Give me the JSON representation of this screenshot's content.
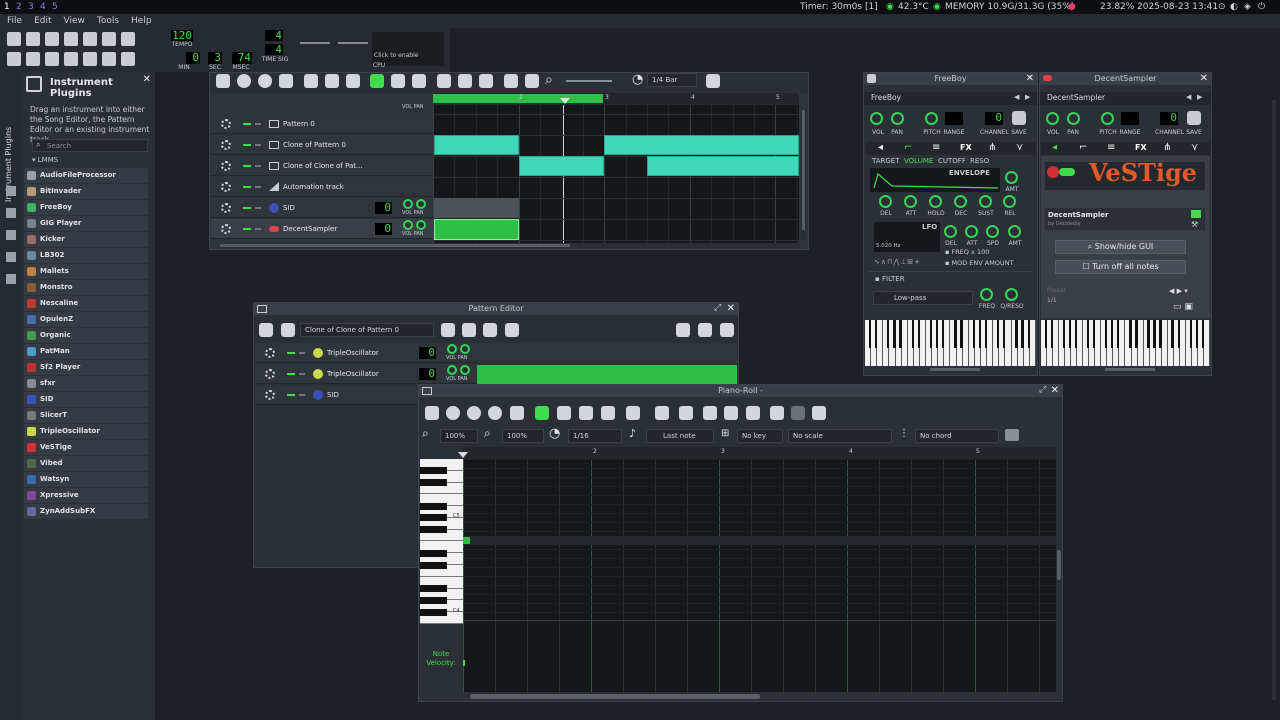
{
  "system_bar": {
    "workspaces": [
      "1",
      "2",
      "3",
      "4",
      "5"
    ],
    "timer": "Timer: 30m0s [1]",
    "temp": "42.3°C",
    "memory": "MEMORY 10.9G/31.3G (35%)",
    "cpu": "23.82%",
    "datetime": "2025-08-23 13:41"
  },
  "menu": [
    "File",
    "Edit",
    "View",
    "Tools",
    "Help"
  ],
  "toolbar": {
    "tempo_value": "120",
    "tempo_label": "TEMPO",
    "min_value": "0",
    "min_label": "MIN",
    "sec_value": "3",
    "sec_label": "SEC",
    "msec_value": "74",
    "msec_label": "MSEC",
    "timesig_num": "4",
    "timesig_den": "4",
    "timesig_label": "TIME SIG",
    "cpu_hint": "Click to enable",
    "cpu_label": "CPU"
  },
  "left_tabs": [
    "Instrument Plugins"
  ],
  "sidebar": {
    "title": "Instrument Plugins",
    "description": "Drag an instrument into either the Song Editor, the Pattern Editor or an existing instrument track.",
    "search_placeholder": "Search",
    "group": "LMMS",
    "plugins": [
      "AudioFileProcessor",
      "BitInvader",
      "FreeBoy",
      "GIG Player",
      "Kicker",
      "LB302",
      "Mallets",
      "Monstro",
      "Nescaline",
      "OpulenZ",
      "Organic",
      "PatMan",
      "Sf2 Player",
      "sfxr",
      "SID",
      "SlicerT",
      "TripleOscillator",
      "VeSTige",
      "Vibed",
      "Watsyn",
      "Xpressive",
      "ZynAddSubFX"
    ]
  },
  "song_editor": {
    "snap": "1/4 Bar",
    "ruler": [
      "2",
      "3",
      "4",
      "5"
    ],
    "vol_pan": "VOL PAN",
    "tracks": [
      {
        "name": "Pattern 0"
      },
      {
        "name": "Clone of Pattern 0"
      },
      {
        "name": "Clone of Clone of Pat..."
      },
      {
        "name": "Automation track"
      },
      {
        "name": "SID",
        "value": "0"
      },
      {
        "name": "DecentSampler",
        "value": "0"
      }
    ]
  },
  "freeboy": {
    "title": "FreeBoy",
    "name": "FreeBoy",
    "knob_labels": [
      "VOL",
      "PAN",
      "PITCH",
      "RANGE",
      "CHANNEL",
      "SAVE"
    ],
    "channel_value": "0",
    "tabs": [
      "TARGET",
      "VOLUME",
      "CUTOFF",
      "RESO"
    ],
    "envelope_label": "ENVELOPE",
    "env_knobs": [
      "DEL",
      "ATT",
      "HOLD",
      "DEC",
      "SUST",
      "REL"
    ],
    "amt_label": "AMT",
    "lfo_label": "LFO",
    "lfo_knobs": [
      "DEL",
      "ATT",
      "SPD",
      "AMT"
    ],
    "lfo_time": "5.020 Hz",
    "freq_x100": "FREQ x 100",
    "mod_env": "MOD ENV AMOUNT",
    "filter_label": "FILTER",
    "filter_type": "Low-pass",
    "filter_knobs": [
      "FREQ",
      "Q/RESO"
    ]
  },
  "decentsampler": {
    "title": "DecentSampler",
    "name": "DecentSampler",
    "knob_labels": [
      "VOL",
      "PAN",
      "PITCH",
      "RANGE",
      "CHANNEL",
      "SAVE"
    ],
    "channel_value": "0",
    "logo": "VeSTige",
    "plugin_name": "DecentSampler",
    "plugin_by": "by Decidedly",
    "show_gui": "Show/hide GUI",
    "turn_off": "Turn off all notes",
    "preset": "Preset",
    "preset_page": "1/1"
  },
  "pattern_editor": {
    "title": "Pattern Editor",
    "pattern": "Clone of Clone of Pattern 0",
    "vol_pan": "VOL PAN",
    "tracks": [
      {
        "name": "TripleOscillator",
        "value": "0"
      },
      {
        "name": "TripleOscillator",
        "value": "0"
      },
      {
        "name": "SID"
      }
    ]
  },
  "piano_roll": {
    "title": "Piano-Roll -",
    "zoom_x": "100%",
    "zoom_y": "100%",
    "quant": "1/16",
    "note_len": "Last note",
    "key": "No key",
    "scale": "No scale",
    "chord": "No chord",
    "ruler": [
      "2",
      "3",
      "4",
      "5"
    ],
    "octaves": [
      "C5",
      "C4"
    ],
    "note_velocity": "Note Velocity:"
  },
  "colors": {
    "accent_green": "#3fdc4b",
    "clip_teal": "#3ed8b8",
    "knob_green": "#35d45a"
  }
}
